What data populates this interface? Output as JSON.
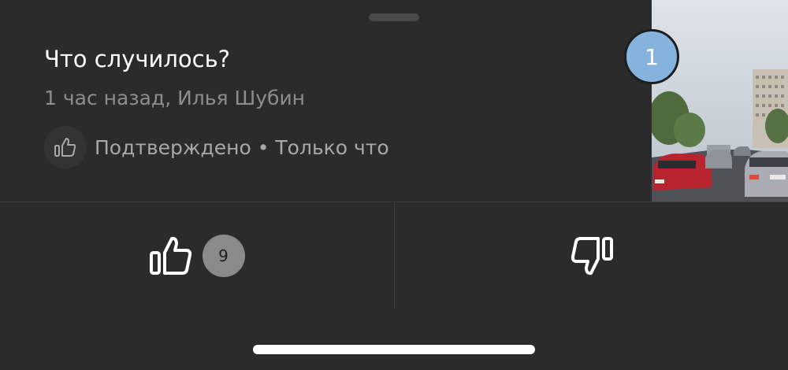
{
  "event": {
    "title": "Что случилось?",
    "meta": "1 час назад, Илья Шубин",
    "status": "Подтверждено • Только что",
    "status_icon": "thumbs-up-icon",
    "photo_count": "1"
  },
  "votes": {
    "like_icon": "thumbs-up-icon",
    "like_count": "9",
    "dislike_icon": "thumbs-down-icon"
  },
  "colors": {
    "background": "#2b2b2b",
    "badge": "#86b3de",
    "like_count_bg": "#8a8a8a"
  }
}
